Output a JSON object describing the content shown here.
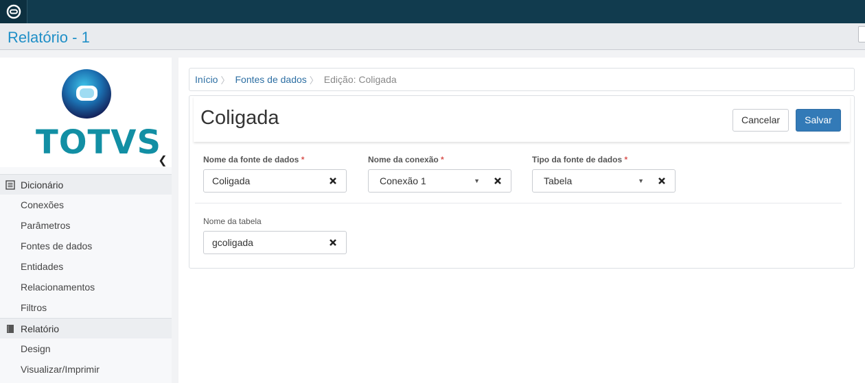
{
  "window": {
    "title": "Relatório - 1"
  },
  "brand": {
    "logo_text": "TOTVS",
    "logo_color": "#128fa4"
  },
  "sidebar": {
    "groups": [
      {
        "label": "Dicionário",
        "icon": "list-icon",
        "items": [
          "Conexões",
          "Parâmetros",
          "Fontes de dados",
          "Entidades",
          "Relacionamentos",
          "Filtros"
        ]
      },
      {
        "label": "Relatório",
        "icon": "book-icon",
        "items": [
          "Design",
          "Visualizar/Imprimir"
        ]
      }
    ]
  },
  "breadcrumb": {
    "items": [
      "Início",
      "Fontes de dados"
    ],
    "current": "Edição: Coligada"
  },
  "form": {
    "title": "Coligada",
    "cancel_label": "Cancelar",
    "save_label": "Salvar",
    "required_marker": "*",
    "fields": {
      "data_source_name": {
        "label": "Nome da fonte de dados",
        "value": "Coligada"
      },
      "connection_name": {
        "label": "Nome da conexão",
        "value": "Conexão 1"
      },
      "data_source_type": {
        "label": "Tipo da fonte de dados",
        "value": "Tabela"
      },
      "table_name": {
        "label": "Nome da tabela",
        "value": "gcoligada"
      }
    }
  },
  "colors": {
    "topbar": "#113b4e",
    "title": "#1f8fc7",
    "primary": "#337ab7",
    "required": "#d9534f"
  }
}
